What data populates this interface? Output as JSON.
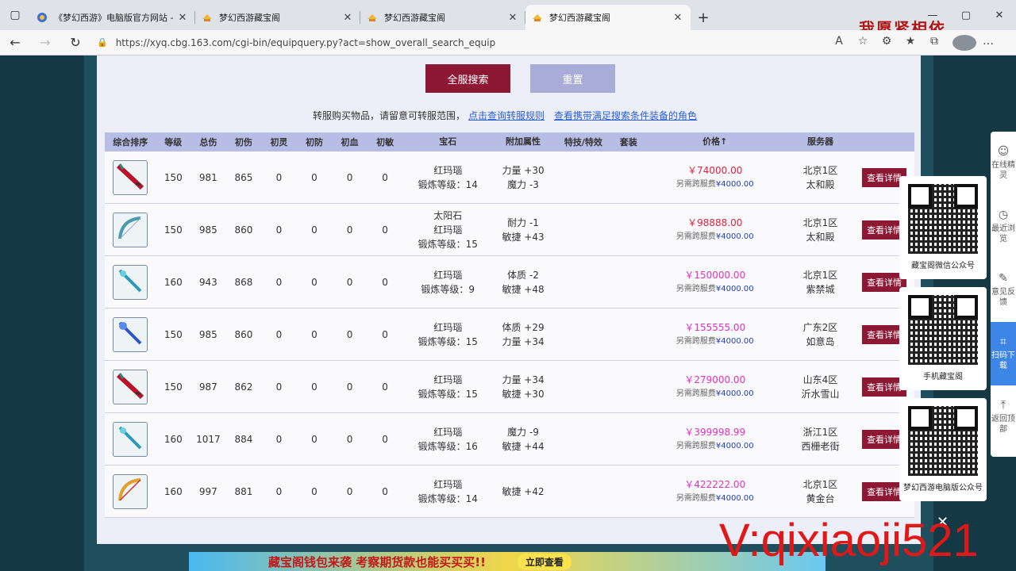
{
  "browser": {
    "tabs": [
      {
        "title": "《梦幻西游》电脑版官方网站 - ",
        "active": false
      },
      {
        "title": "梦幻西游藏宝阁",
        "active": false
      },
      {
        "title": "梦幻西游藏宝阁",
        "active": false
      },
      {
        "title": "梦幻西游藏宝阁",
        "active": true
      }
    ],
    "url": "https://xyq.cbg.163.com/cgi-bin/equipquery.py?act=show_overall_search_equip"
  },
  "watermark_top": "我愿紧相依",
  "watermark_bottom": "V:qixiaoji521",
  "buttons": {
    "search": "全服搜索",
    "reset": "重置"
  },
  "notice": {
    "text": "转服购买物品，请留意可转服范围，",
    "link1": "点击查询转服规则",
    "link2": "查看携带满足搜索条件装备的角色"
  },
  "table": {
    "headers": [
      "综合排序",
      "等级",
      "总伤",
      "初伤",
      "初灵",
      "初防",
      "初血",
      "初敏",
      "宝石",
      "附加属性",
      "特技/特效",
      "套装",
      "价格↑",
      "服务器"
    ],
    "detail_label": "查看详情",
    "fee_prefix": "另需跨服费",
    "fee_value": "¥4000.00",
    "rows": [
      {
        "icon": "red-sword",
        "level": "150",
        "total": "981",
        "init_dmg": "865",
        "ling": "0",
        "def": "0",
        "hp": "0",
        "spd": "0",
        "gem": [
          "红玛瑙",
          "锻炼等级：14"
        ],
        "attr": [
          "力量 +30",
          "魔力 -3"
        ],
        "price": "￥74000.00",
        "price_color": "red",
        "server": [
          "北京1区",
          "太和殿"
        ]
      },
      {
        "icon": "blue-bow",
        "level": "150",
        "total": "985",
        "init_dmg": "860",
        "ling": "0",
        "def": "0",
        "hp": "0",
        "spd": "0",
        "gem": [
          "太阳石",
          "红玛瑙",
          "锻炼等级：15"
        ],
        "attr": [
          "耐力 -1",
          "敏捷 +43"
        ],
        "price": "￥98888.00",
        "price_color": "red",
        "server": [
          "北京1区",
          "太和殿"
        ]
      },
      {
        "icon": "cyan-staff",
        "level": "160",
        "total": "943",
        "init_dmg": "868",
        "ling": "0",
        "def": "0",
        "hp": "0",
        "spd": "0",
        "gem": [
          "红玛瑙",
          "锻炼等级：9"
        ],
        "attr": [
          "体质 -2",
          "敏捷 +48"
        ],
        "price": "￥150000.00",
        "price_color": "pink",
        "server": [
          "北京1区",
          "紫禁城"
        ]
      },
      {
        "icon": "blue-staff",
        "level": "150",
        "total": "985",
        "init_dmg": "860",
        "ling": "0",
        "def": "0",
        "hp": "0",
        "spd": "0",
        "gem": [
          "红玛瑙",
          "锻炼等级：15"
        ],
        "attr": [
          "体质 +29",
          "力量 +34"
        ],
        "price": "￥155555.00",
        "price_color": "pink",
        "server": [
          "广东2区",
          "如意岛"
        ]
      },
      {
        "icon": "red-sword",
        "level": "150",
        "total": "987",
        "init_dmg": "862",
        "ling": "0",
        "def": "0",
        "hp": "0",
        "spd": "0",
        "gem": [
          "红玛瑙",
          "锻炼等级：15"
        ],
        "attr": [
          "力量 +34",
          "敏捷 +30"
        ],
        "price": "￥279000.00",
        "price_color": "pink",
        "server": [
          "山东4区",
          "沂水雪山"
        ]
      },
      {
        "icon": "cyan-staff",
        "level": "160",
        "total": "1017",
        "init_dmg": "884",
        "ling": "0",
        "def": "0",
        "hp": "0",
        "spd": "0",
        "gem": [
          "红玛瑙",
          "锻炼等级：16"
        ],
        "attr": [
          "魔力 -9",
          "敏捷 +44"
        ],
        "price": "￥399998.99",
        "price_color": "pink",
        "server": [
          "浙江1区",
          "西栅老街"
        ]
      },
      {
        "icon": "gold-bow",
        "level": "160",
        "total": "997",
        "init_dmg": "881",
        "ling": "0",
        "def": "0",
        "hp": "0",
        "spd": "0",
        "gem": [
          "红玛瑙",
          "锻炼等级：14"
        ],
        "attr": [
          "敏捷 +42"
        ],
        "price": "￥422222.00",
        "price_color": "pink",
        "server": [
          "北京1区",
          "黄金台"
        ]
      }
    ]
  },
  "sidebar": [
    {
      "label": "在线精灵",
      "icon": "sprite-icon"
    },
    {
      "label": "最近浏览",
      "icon": "clock-icon"
    },
    {
      "label": "意见反馈",
      "icon": "edit-icon"
    },
    {
      "label": "扫码下载",
      "icon": "scan-icon",
      "active": true
    },
    {
      "label": "返回顶部",
      "icon": "arrow-up-icon"
    }
  ],
  "qr_cards": [
    {
      "label": "藏宝阁微信公众号"
    },
    {
      "label": "手机藏宝阁"
    },
    {
      "label": "梦幻西游电脑版公众号"
    }
  ],
  "banner": {
    "text": "藏宝阁钱包来袭 考察期货款也能买买买!!",
    "button": "立即查看"
  }
}
